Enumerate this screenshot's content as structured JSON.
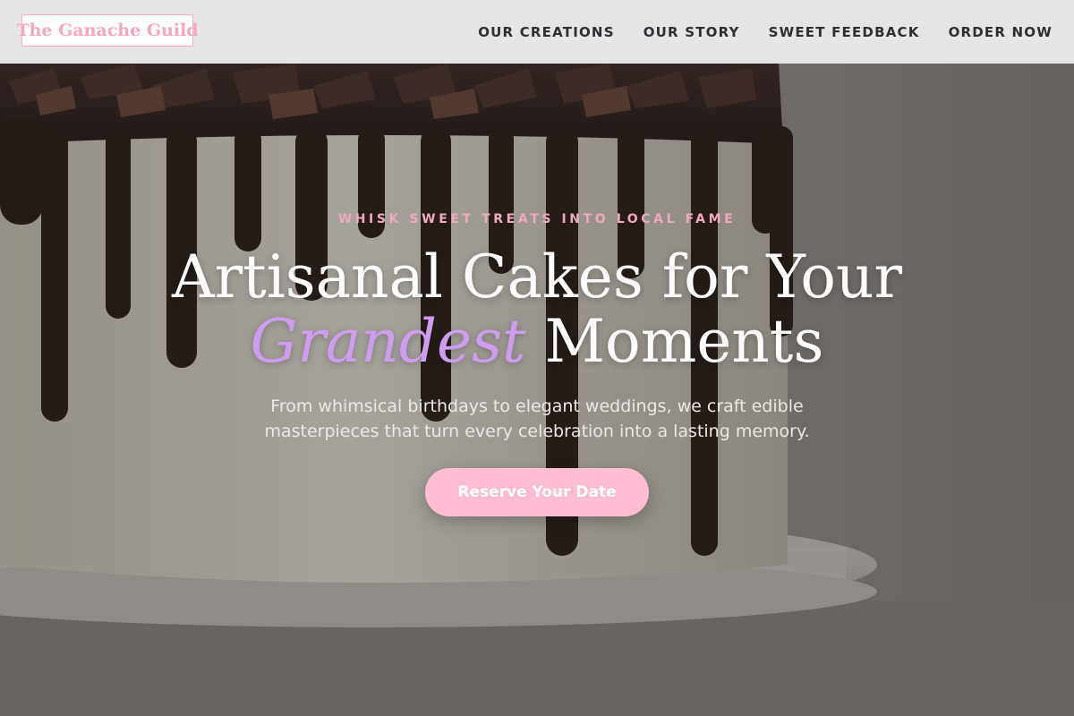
{
  "header": {
    "logo_text": "The Ganache Guild",
    "nav": [
      {
        "label": "OUR CREATIONS"
      },
      {
        "label": "OUR STORY"
      },
      {
        "label": "SWEET FEEDBACK"
      },
      {
        "label": "ORDER NOW"
      }
    ]
  },
  "hero": {
    "eyebrow": "WHISK SWEET TREATS INTO LOCAL FAME",
    "headline_line1": "Artisanal Cakes for Your",
    "headline_accent": "Grandest",
    "headline_line2_rest": "Moments",
    "subtitle": "From whimsical birthdays to elegant weddings, we craft edible masterpieces that turn every celebration into a lasting memory.",
    "cta_label": "Reserve Your Date"
  },
  "colors": {
    "accent_pink": "#ffbcd2",
    "accent_purple": "#cf9df0",
    "header_bg": "#e6e5e5",
    "nav_text": "#2e2e33"
  }
}
